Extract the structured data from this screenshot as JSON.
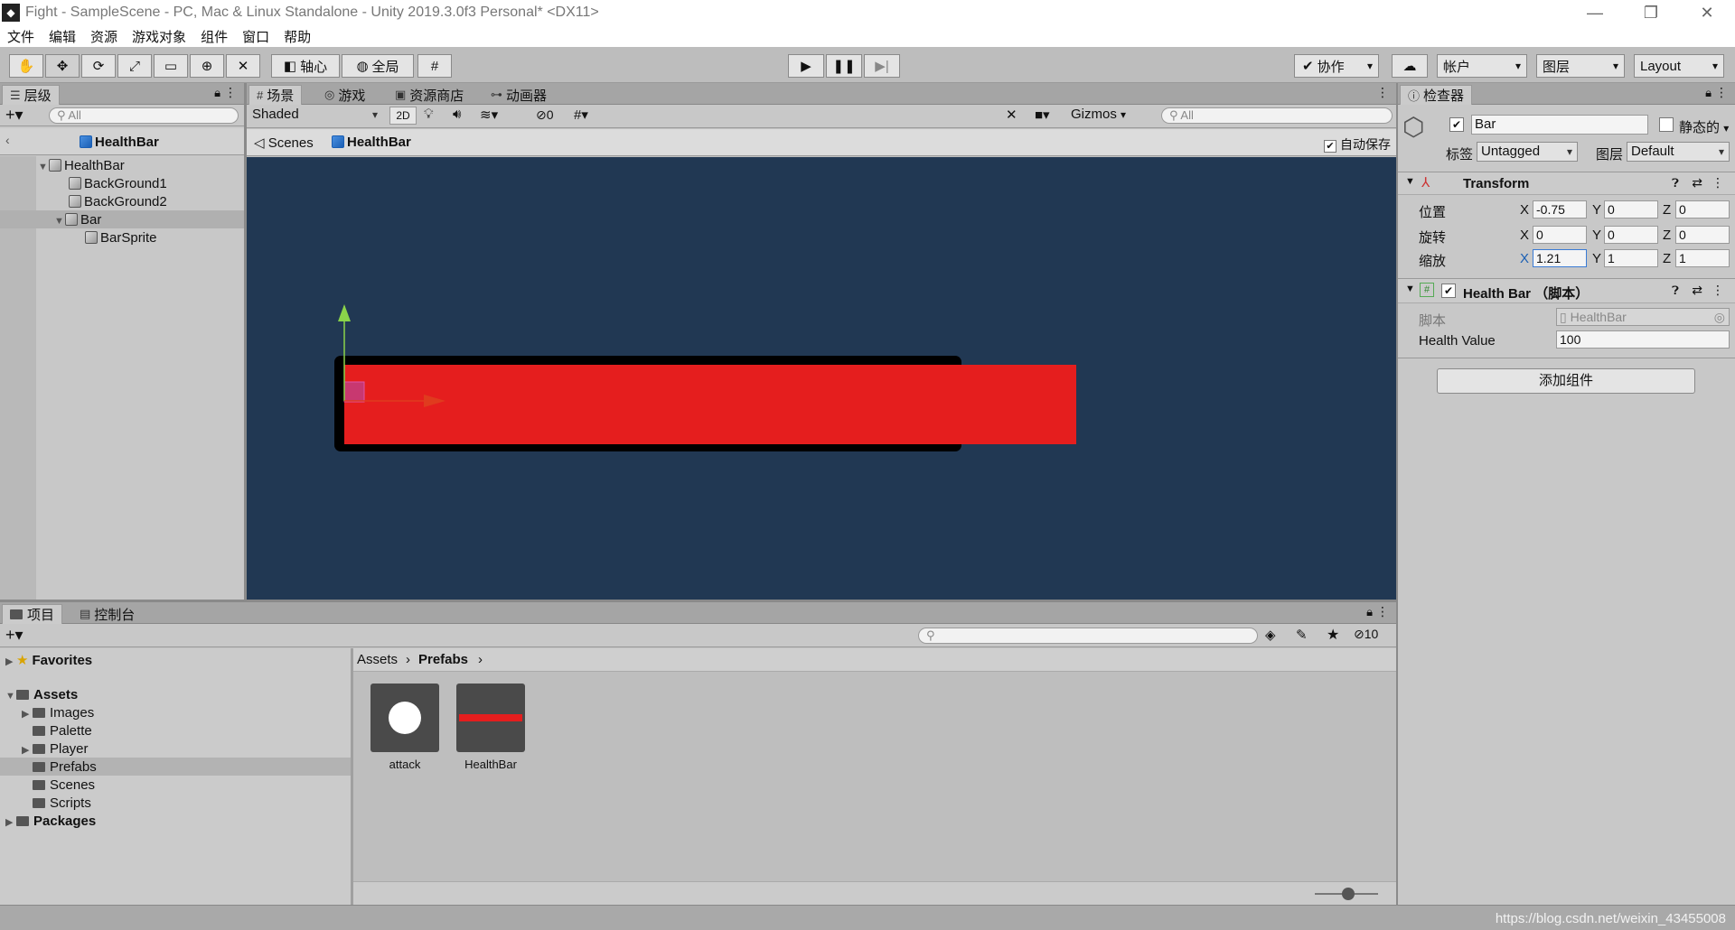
{
  "window": {
    "title": "Fight - SampleScene - PC, Mac & Linux Standalone - Unity 2019.3.0f3 Personal* <DX11>",
    "controls": [
      "—",
      "❐",
      "✕"
    ]
  },
  "menu": [
    "文件",
    "编辑",
    "资源",
    "游戏对象",
    "组件",
    "窗口",
    "帮助"
  ],
  "toolbar": {
    "pivot": "轴心",
    "global": "全局",
    "collab": "协作",
    "account": "帐户",
    "layers": "图层",
    "layout": "Layout"
  },
  "hierarchy": {
    "tab": "层级",
    "search_placeholder": "All",
    "scene_root": "HealthBar",
    "items": [
      {
        "label": "HealthBar"
      },
      {
        "label": "BackGround1"
      },
      {
        "label": "BackGround2"
      },
      {
        "label": "Bar"
      },
      {
        "label": "BarSprite"
      }
    ]
  },
  "scene": {
    "tabs": [
      "场景",
      "游戏",
      "资源商店",
      "动画器"
    ],
    "shading": "Shaded",
    "mode2d": "2D",
    "hidden_count": "0",
    "gizmos": "Gizmos",
    "search_placeholder": "All",
    "breadcrumb_scenes": "Scenes",
    "breadcrumb_prefab": "HealthBar",
    "autosave": "自动保存",
    "colors": {
      "background": "#213853",
      "bar": "#e51e1e",
      "frame": "#000000"
    }
  },
  "inspector": {
    "tab": "检查器",
    "object_name": "Bar",
    "static_label": "静态的",
    "tag_label": "标签",
    "tag_value": "Untagged",
    "layer_label": "图层",
    "layer_value": "Default",
    "transform_title": "Transform",
    "position_label": "位置",
    "rotation_label": "旋转",
    "scale_label": "缩放",
    "position": {
      "x": "-0.75",
      "y": "0",
      "z": "0"
    },
    "rotation": {
      "x": "0",
      "y": "0",
      "z": "0"
    },
    "scale": {
      "x": "1.21",
      "y": "1",
      "z": "1"
    },
    "script_component_title": "Health Bar （脚本）",
    "script_label": "脚本",
    "script_value": "HealthBar",
    "health_label": "Health Value",
    "health_value": "100",
    "add_component": "添加组件"
  },
  "project": {
    "tabs": [
      "项目",
      "控制台"
    ],
    "hidden_count": "10",
    "favorites": "Favorites",
    "assets": "Assets",
    "folders": [
      "Images",
      "Palette",
      "Player",
      "Prefabs",
      "Scenes",
      "Scripts"
    ],
    "packages": "Packages",
    "breadcrumb": [
      "Assets",
      "Prefabs"
    ],
    "items": [
      {
        "label": "attack"
      },
      {
        "label": "HealthBar"
      }
    ]
  },
  "watermark": "https://blog.csdn.net/weixin_43455008"
}
